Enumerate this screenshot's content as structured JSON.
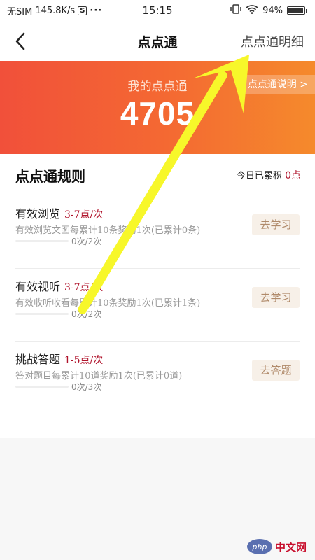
{
  "status_bar": {
    "carrier": "无SIM",
    "speed": "145.8K/s",
    "sim_icon_text": "S",
    "more": "···",
    "time": "15:15",
    "battery": "94%",
    "battery_level": 0.94
  },
  "nav": {
    "back_icon": "chevron-left-icon",
    "title": "点点通",
    "detail_link": "点点通明细"
  },
  "banner": {
    "caption": "我的点点通",
    "points": "4705",
    "explain_link": "点点通说明 >"
  },
  "rules": {
    "title": "点点通规则",
    "today_label": "今日已累积",
    "today_value": "0点",
    "items": [
      {
        "name": "有效浏览",
        "points": "3-7点/次",
        "desc": "有效浏览文图每累计10条奖励1次(已累计0条)",
        "progress_text": "0次/2次",
        "progress": 0,
        "action": "去学习"
      },
      {
        "name": "有效视听",
        "points": "3-7点/次",
        "desc": "有效收听收看每累计10条奖励1次(已累计1条)",
        "progress_text": "0次/2次",
        "progress": 0,
        "action": "去学习"
      },
      {
        "name": "挑战答题",
        "points": "1-5点/次",
        "desc": "答对题目每累计10道奖励1次(已累计0道)",
        "progress_text": "0次/3次",
        "progress": 0,
        "action": "去答题"
      }
    ]
  },
  "annotation": {
    "arrow_color": "#f7f72a"
  },
  "watermark": {
    "logo": "php",
    "text": "中文网"
  }
}
